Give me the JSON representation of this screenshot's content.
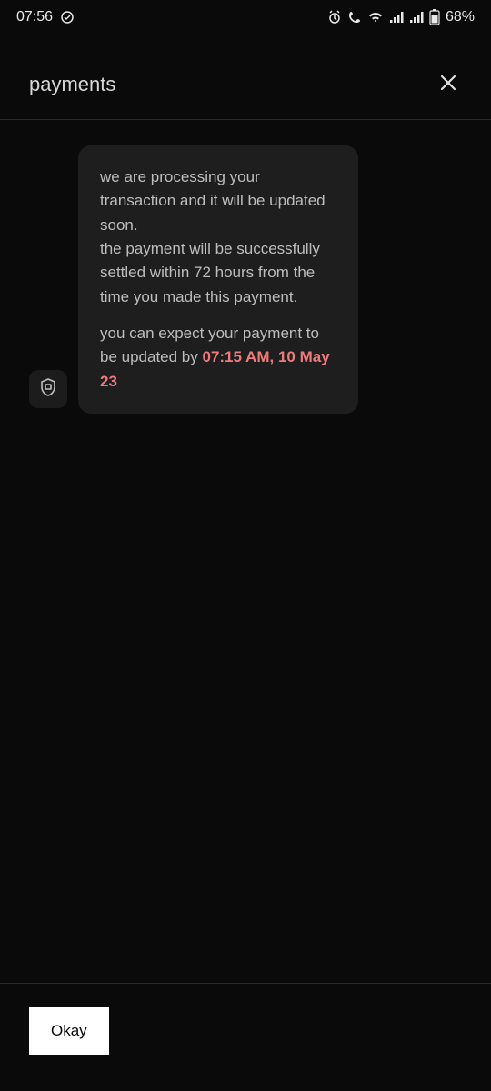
{
  "status_bar": {
    "time": "07:56",
    "battery_percent": "68%"
  },
  "header": {
    "title": "payments"
  },
  "message": {
    "para1": "we are processing your transaction and it will be updated soon.",
    "para2": "the payment will be successfully settled within 72 hours from the time you made this payment.",
    "para3_prefix": "you can expect your payment to be updated by ",
    "para3_highlight": "07:15 AM, 10 May 23"
  },
  "footer": {
    "okay_label": "Okay"
  }
}
